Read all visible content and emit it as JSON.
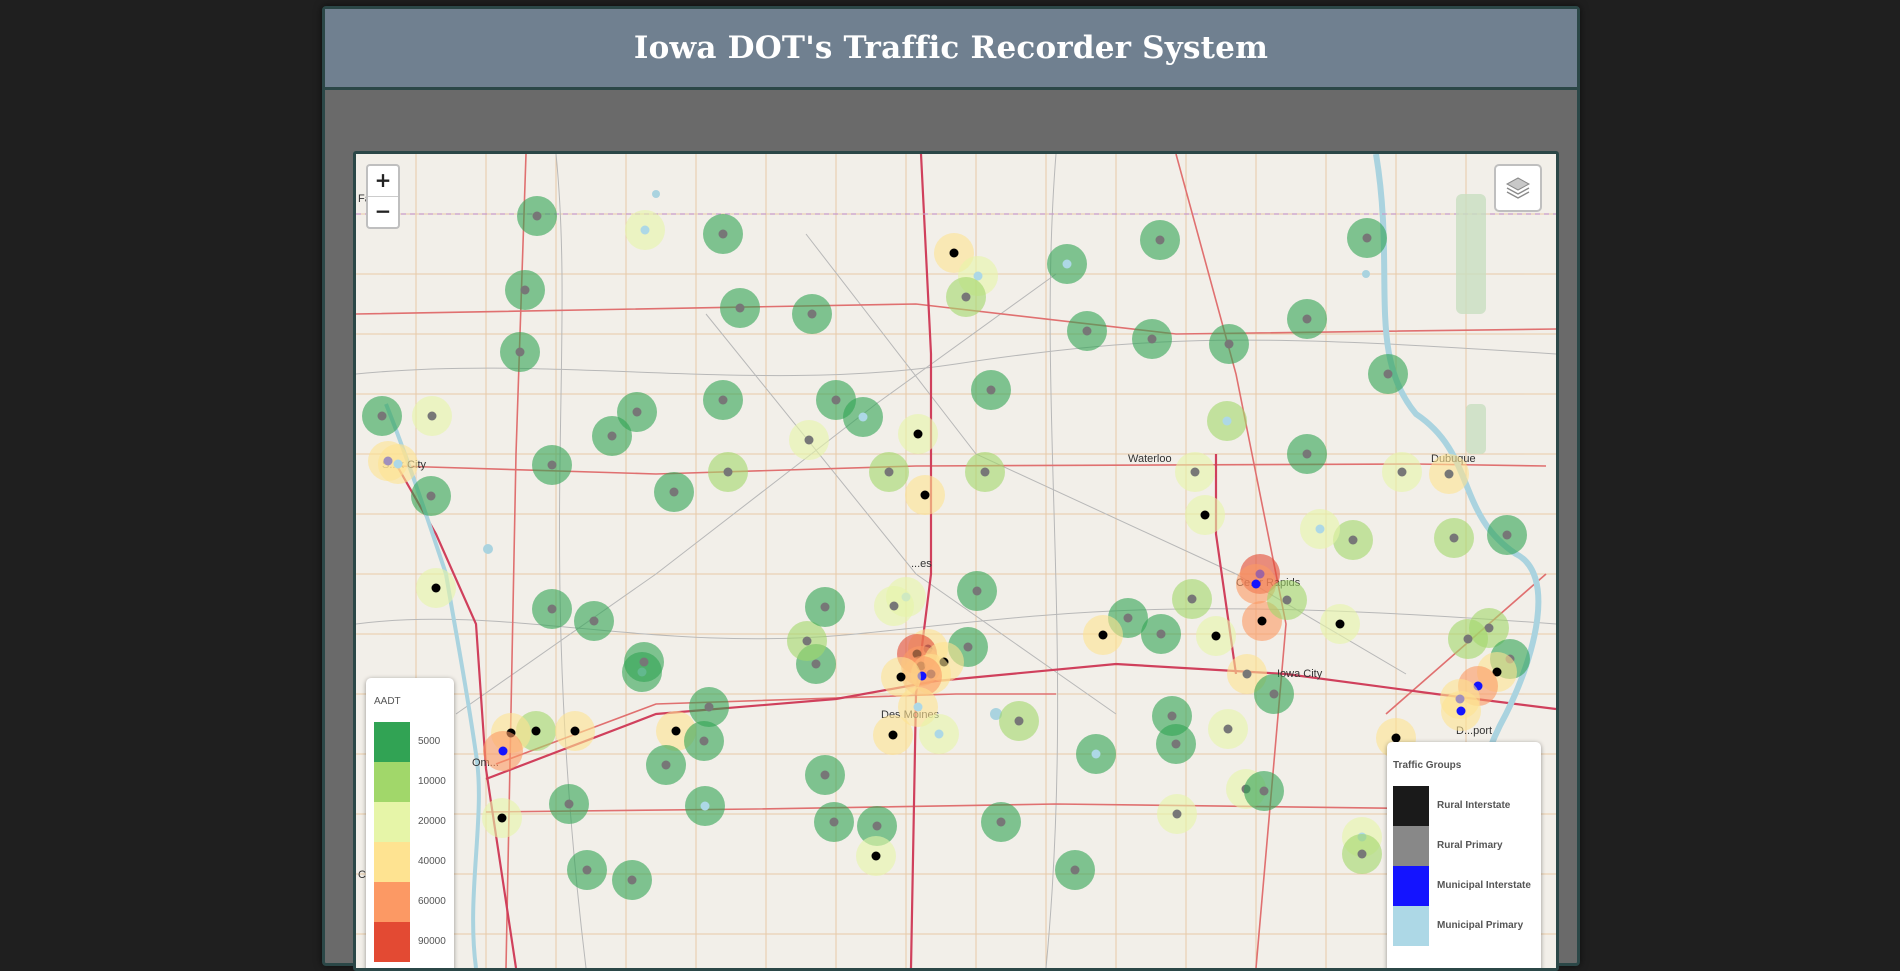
{
  "header": {
    "title": "Iowa DOT's Traffic Recorder System"
  },
  "map": {
    "zoom_in_label": "+",
    "zoom_out_label": "−",
    "layers_icon": "layers-icon",
    "city_labels": [
      {
        "name": "Waterloo"
      },
      {
        "name": "Dubuque"
      },
      {
        "name": "Iowa City"
      },
      {
        "name": "Des Moines"
      },
      {
        "name": "Ce...r Rapids"
      },
      {
        "name": "S...x City"
      },
      {
        "name": "Om..."
      },
      {
        "name": "D...port"
      },
      {
        "name": "Fa..."
      },
      {
        "name": "Co..."
      },
      {
        "name": "...es"
      }
    ]
  },
  "aadt_legend": {
    "title": "AADT",
    "items": [
      {
        "label": "5000",
        "color": "#31a354"
      },
      {
        "label": "10000",
        "color": "#a1d76a"
      },
      {
        "label": "20000",
        "color": "#e6f5a8"
      },
      {
        "label": "40000",
        "color": "#fee391"
      },
      {
        "label": "60000",
        "color": "#fc9964"
      },
      {
        "label": "90000",
        "color": "#e34a33"
      }
    ]
  },
  "traffic_groups_legend": {
    "title": "Traffic Groups",
    "items": [
      {
        "label": "Rural Interstate",
        "color": "#1a1a1a"
      },
      {
        "label": "Rural Primary",
        "color": "#888888"
      },
      {
        "label": "Municipal Interstate",
        "color": "#1414ff"
      },
      {
        "label": "Municipal Primary",
        "color": "#add8e6"
      }
    ]
  }
}
